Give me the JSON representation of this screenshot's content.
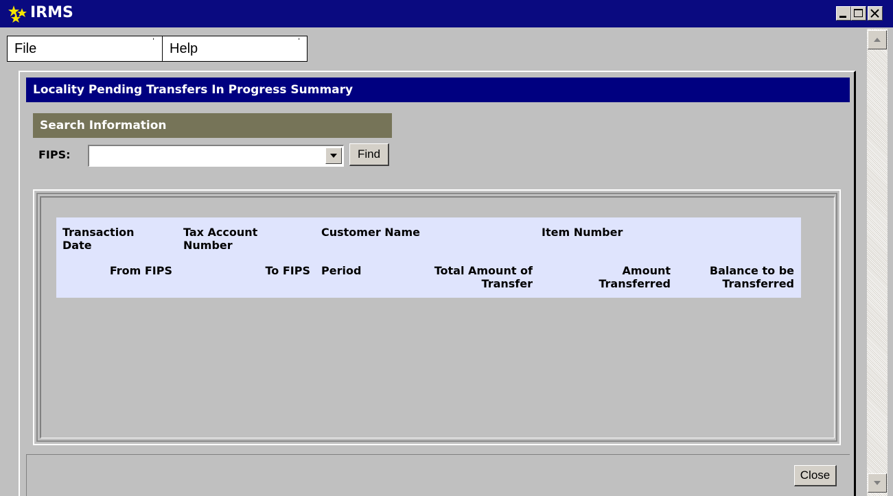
{
  "window": {
    "title": "IRMS",
    "icon": "stars-icon"
  },
  "menu": {
    "items": [
      {
        "label": "File"
      },
      {
        "label": "Help"
      }
    ]
  },
  "panel": {
    "title": "Locality Pending Transfers In Progress Summary"
  },
  "search": {
    "header": "Search Information",
    "fips_label": "FIPS:",
    "fips_value": "",
    "find_label": "Find"
  },
  "grid": {
    "columns_row1": [
      "Transaction Date",
      "Tax Account Number",
      "Customer Name",
      "Item Number"
    ],
    "columns_row2": [
      "From FIPS",
      "To FIPS",
      "Period",
      "Total Amount of Transfer",
      "Amount Transferred",
      "Balance to be Transferred"
    ],
    "rows": []
  },
  "footer": {
    "close_label": "Close"
  },
  "colors": {
    "title_bar": "#0a0a80",
    "panel_header": "#000080",
    "search_header": "#767458",
    "grid_header": "#dfe4fd",
    "background": "#c0c0c0"
  }
}
